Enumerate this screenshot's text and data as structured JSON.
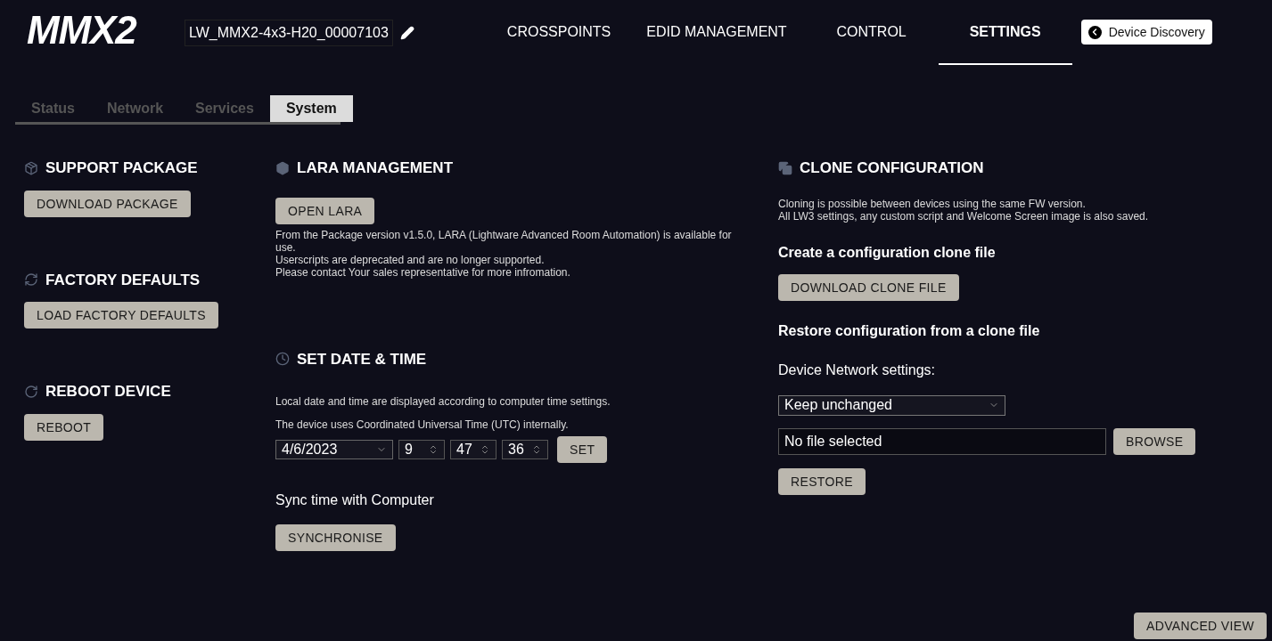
{
  "header": {
    "logo": "MMX2",
    "device_name": "LW_MMX2-4x3-H20_00007103",
    "nav": [
      {
        "label": "CROSSPOINTS",
        "selected": false
      },
      {
        "label": "EDID MANAGEMENT",
        "selected": false
      },
      {
        "label": "CONTROL",
        "selected": false
      },
      {
        "label": "SETTINGS",
        "selected": true
      }
    ],
    "discovery_button": "Device Discovery"
  },
  "tabs": [
    {
      "label": "Status",
      "selected": false
    },
    {
      "label": "Network",
      "selected": false
    },
    {
      "label": "Services",
      "selected": false
    },
    {
      "label": "System",
      "selected": true
    }
  ],
  "left": [
    {
      "kind": "package",
      "title": "SUPPORT PACKAGE",
      "button": "DOWNLOAD PACKAGE"
    },
    {
      "kind": "refresh",
      "title": "FACTORY DEFAULTS",
      "button": "LOAD FACTORY DEFAULTS"
    },
    {
      "kind": "reboot",
      "title": "REBOOT DEVICE",
      "button": "REBOOT"
    }
  ],
  "lara": {
    "title": "LARA MANAGEMENT",
    "button": "OPEN LARA",
    "lines": [
      "From the Package version v1.5.0, LARA (Lightware Advanced Room Automation) is available for use.",
      "Userscripts are deprecated and are no longer supported.",
      "Please contact Your sales representative for more infromation."
    ]
  },
  "datetime": {
    "title": "SET DATE & TIME",
    "notes": [
      "Local date and time are displayed according to computer time settings.",
      "The device uses Coordinated Universal Time (UTC) internally."
    ],
    "date": "4/6/2023",
    "hour": "9",
    "minute": "47",
    "second": "36",
    "set_button": "SET",
    "sync_label": "Sync time with Computer",
    "sync_button": "SYNCHRONISE"
  },
  "clone": {
    "title": "CLONE CONFIGURATION",
    "lines": [
      "Cloning is possible between devices using the same FW version.",
      "All LW3 settings, any custom script and Welcome Screen image is also saved."
    ],
    "create_heading": "Create a configuration clone file",
    "download_button": "DOWNLOAD CLONE FILE",
    "restore_heading": "Restore configuration from a clone file",
    "network_label": "Device Network settings:",
    "network_value": "Keep unchanged",
    "file_value": "No file selected",
    "browse_button": "BROWSE",
    "restore_button": "RESTORE"
  },
  "advanced_button": "ADVANCED VIEW"
}
